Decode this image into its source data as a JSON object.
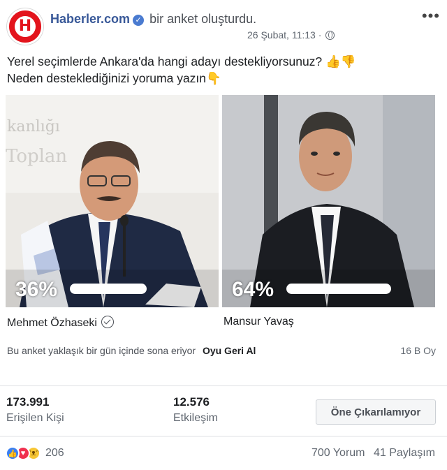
{
  "post": {
    "page_name": "Haberler.com",
    "action": "bir anket oluşturdu.",
    "date": "26 Şubat, 11:13 ·",
    "logo_letter": "H",
    "question_line1": "Yerel seçimlerde Ankara'da hangi adayı destekliyorsunuz? 👍👎",
    "question_line2": "Neden desteklediğinizi yoruma yazın👇"
  },
  "poll": {
    "options": [
      {
        "name": "Mehmet Özhaseki",
        "percent": "36%",
        "selected": true
      },
      {
        "name": "Mansur Yavaş",
        "percent": "64%",
        "selected": false
      }
    ],
    "ends_text": "Bu anket yaklaşık bir gün içinde sona eriyor",
    "undo_label": "Oyu Geri Al",
    "vote_count": "16 B Oy",
    "background_text_line1": "kanlığı",
    "background_text_line2": "Toplan"
  },
  "insights": {
    "reach_value": "173.991",
    "reach_label": "Erişilen Kişi",
    "engagement_value": "12.576",
    "engagement_label": "Etkileşim",
    "boost_label": "Öne Çıkarılamıyor"
  },
  "footer": {
    "reaction_count": "206",
    "comments": "700 Yorum",
    "shares": "41 Paylaşım"
  },
  "colors": {
    "brand_red": "#e3141c",
    "link_blue": "#385898",
    "like_blue": "#3b7ff1",
    "love_red": "#f0304f"
  }
}
